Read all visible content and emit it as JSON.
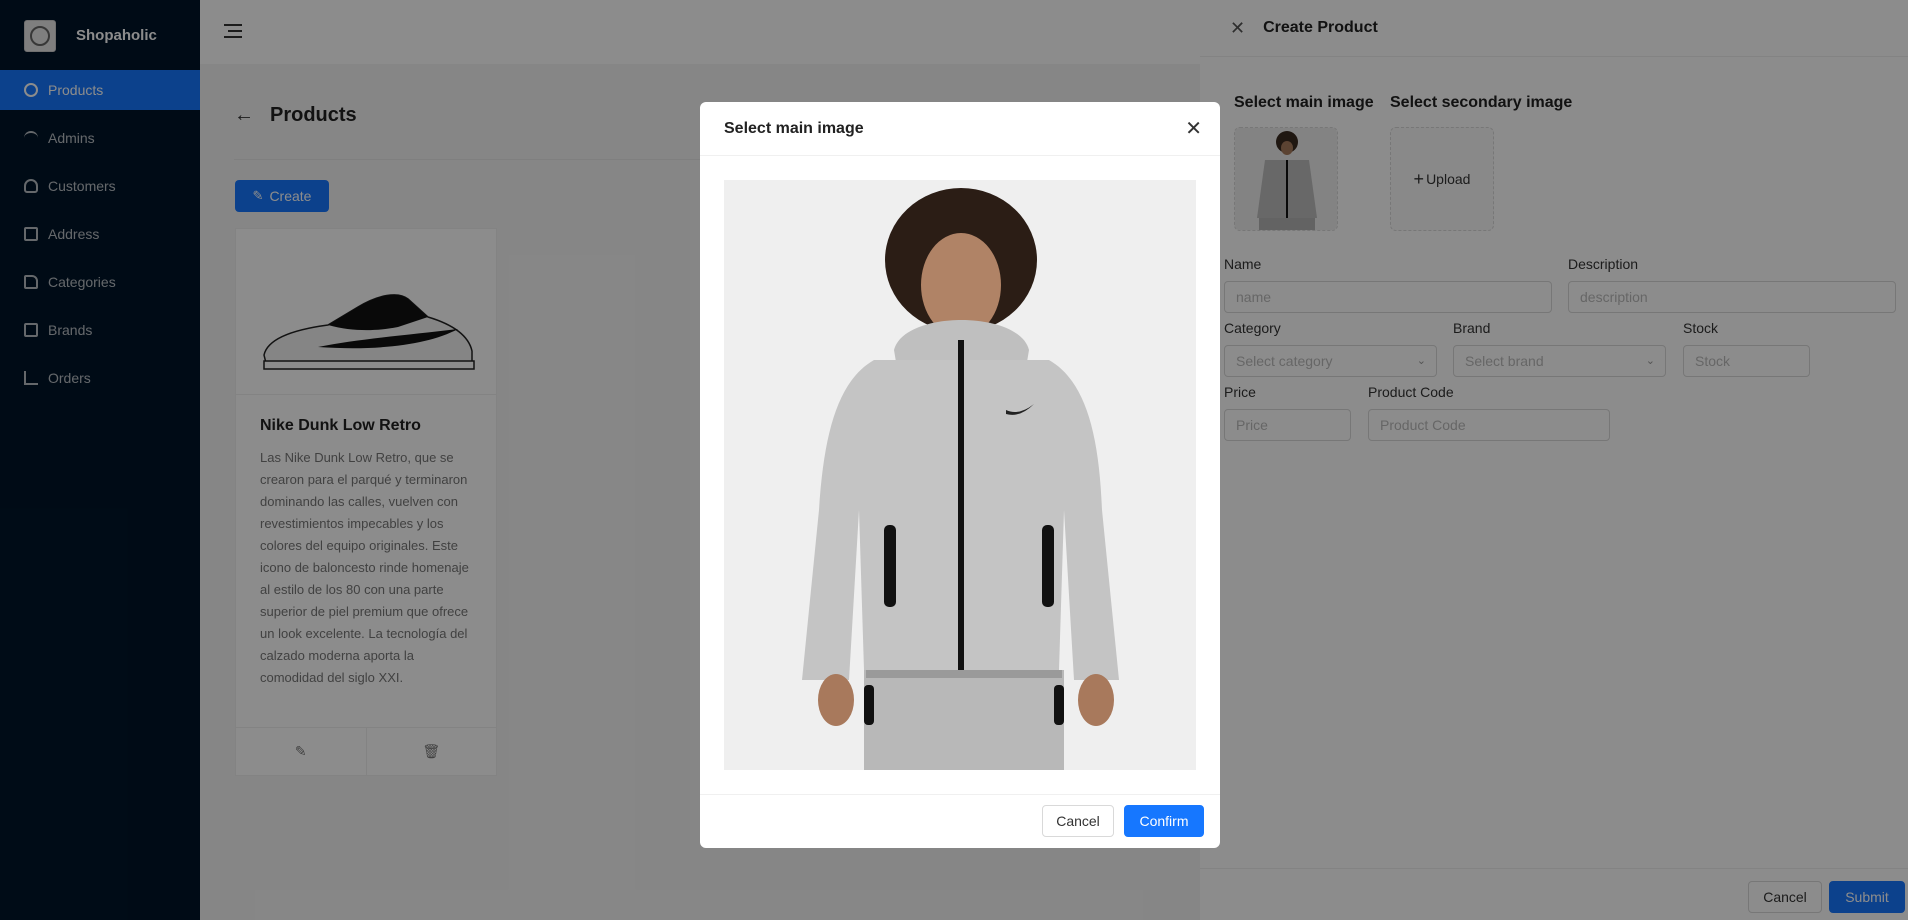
{
  "app": {
    "name": "Shopaholic"
  },
  "sidebar": {
    "items": [
      {
        "label": "Products",
        "icon": "gear-icon",
        "active": true
      },
      {
        "label": "Admins",
        "icon": "wifi-icon",
        "active": false
      },
      {
        "label": "Customers",
        "icon": "user-icon",
        "active": false
      },
      {
        "label": "Address",
        "icon": "link-icon",
        "active": false
      },
      {
        "label": "Categories",
        "icon": "tag-icon",
        "active": false
      },
      {
        "label": "Brands",
        "icon": "card-icon",
        "active": false
      },
      {
        "label": "Orders",
        "icon": "chart-icon",
        "active": false
      }
    ]
  },
  "page": {
    "title": "Products",
    "create_label": "Create"
  },
  "product_card": {
    "title": "Nike Dunk Low Retro",
    "description": "Las Nike Dunk Low Retro, que se crearon para el parqué y terminaron dominando las calles, vuelven con revestimientos impecables y los colores del equipo originales. Este icono de baloncesto rinde homenaje al estilo de los 80 con una parte superior de piel premium que ofrece un look excelente. La tecnología del calzado moderna aporta la comodidad del siglo XXI."
  },
  "drawer": {
    "title": "Create Product",
    "main_image_label": "Select main image",
    "secondary_image_label": "Select secondary image",
    "upload_label": "Upload",
    "fields": {
      "name": {
        "label": "Name",
        "placeholder": "name"
      },
      "description": {
        "label": "Description",
        "placeholder": "description"
      },
      "category": {
        "label": "Category",
        "placeholder": "Select category"
      },
      "brand": {
        "label": "Brand",
        "placeholder": "Select brand"
      },
      "stock": {
        "label": "Stock",
        "placeholder": "Stock"
      },
      "price": {
        "label": "Price",
        "placeholder": "Price"
      },
      "product_code": {
        "label": "Product Code",
        "placeholder": "Product Code"
      }
    },
    "cancel_label": "Cancel",
    "submit_label": "Submit"
  },
  "modal": {
    "title": "Select main image",
    "cancel_label": "Cancel",
    "confirm_label": "Confirm"
  },
  "colors": {
    "primary": "#1677ff",
    "sider": "#001529"
  }
}
